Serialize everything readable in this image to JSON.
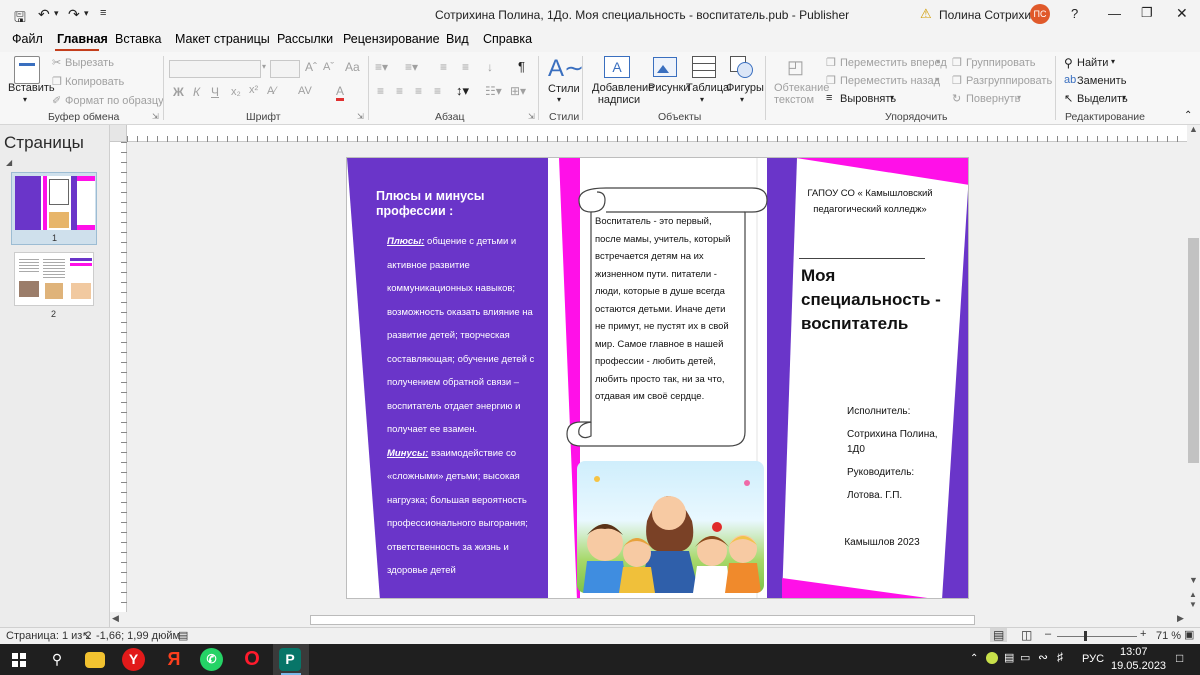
{
  "window": {
    "title": "Сотрихина Полина, 1До. Моя специальность - воспитатель.pub  -  Publisher",
    "user": "Полина Сотрихина",
    "user_initials": "ПС"
  },
  "menu": {
    "tabs": [
      "Файл",
      "Главная",
      "Вставка",
      "Макет страницы",
      "Рассылки",
      "Рецензирование",
      "Вид",
      "Справка"
    ],
    "active": "Главная"
  },
  "ribbon": {
    "clipboard": {
      "paste": "Вставить",
      "cut": "Вырезать",
      "copy": "Копировать",
      "format_painter": "Формат по образцу",
      "group": "Буфер обмена"
    },
    "font": {
      "group": "Шрифт",
      "bold": "Ж",
      "italic": "К",
      "underline": "Ч"
    },
    "paragraph": {
      "group": "Абзац"
    },
    "styles": {
      "label": "Стили",
      "group": "Стили"
    },
    "objects": {
      "textbox": "Добавление надписи",
      "pictures": "Рисунки",
      "table": "Таблица",
      "shapes": "Фигуры",
      "group": "Объекты"
    },
    "arrange": {
      "wrap": "Обтекание текстом",
      "forward": "Переместить вперед",
      "backward": "Переместить назад",
      "align": "Выровнять",
      "group_btn": "Группировать",
      "ungroup": "Разгруппировать",
      "rotate": "Повернуть",
      "group": "Упорядочить"
    },
    "editing": {
      "find": "Найти",
      "replace": "Заменить",
      "select": "Выделить",
      "group": "Редактирование"
    }
  },
  "pages_pane": {
    "title": "Страницы",
    "pages": [
      "1",
      "2"
    ]
  },
  "document": {
    "left_panel": {
      "heading": "Плюсы и минусы профессии :",
      "pros_label": "Плюсы:",
      "pros_text": " общение с детьми и активное развитие коммуникационных навыков; возможность оказать влияние на развитие детей; творческая составляющая; обучение детей с получением обратной связи – воспитатель отдает энергию и получает ее взамен.",
      "cons_label": "Минусы:",
      "cons_text": " взаимодействие со «сложными» детьми; высокая нагрузка; большая вероятность профессионального выгорания; ответственность за жизнь и здоровье детей"
    },
    "scroll_text": "Воспитатель - это первый, после мамы, учитель, который встречается детям на их жизненном пути. питатели - люди, которые в душе всегда остаются детьми. Иначе дети не примут, не пустят их в свой мир. Самое главное в нашей профессии - любить детей, любить просто так, ни за что, отдавая им своё сердце.",
    "cover": {
      "college": "ГАПОУ СО « Камышловский педагогический колледж»",
      "title": "Моя специальность - воспитатель",
      "executor_label": "Исполнитель:",
      "executor": "Сотрихина Полина, 1Д0",
      "supervisor_label": "Руководитель:",
      "supervisor": "Лотова. Г.П.",
      "city_year": "Камышлов 2023"
    }
  },
  "status": {
    "page": "Страница: 1 из 2",
    "position": "-1,66; 1,99 дюйм",
    "zoom": "71 %"
  },
  "taskbar": {
    "lang": "РУС",
    "time": "13:07",
    "date": "19.05.2023"
  },
  "colors": {
    "purple": "#6a35c9",
    "magenta": "#ff10e8",
    "accent_red": "#c43e1c",
    "avatar": "#e0592a"
  }
}
